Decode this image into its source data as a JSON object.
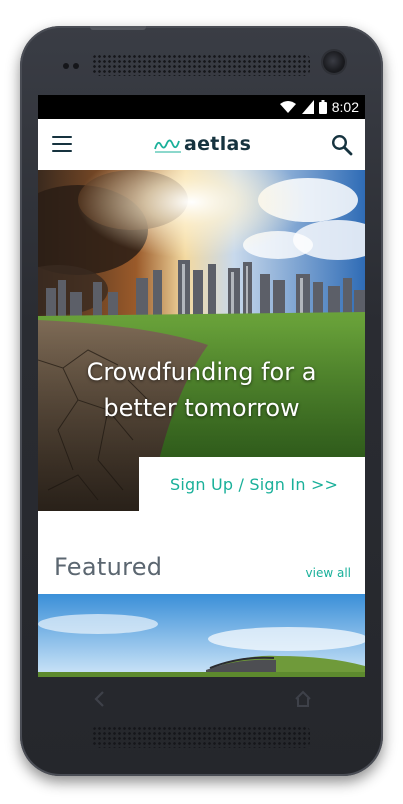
{
  "status_bar": {
    "time": "8:02",
    "icons": [
      "wifi-icon",
      "signal-icon",
      "battery-icon"
    ]
  },
  "app_bar": {
    "brand": "aetlas",
    "menu_icon": "hamburger-menu-icon",
    "search_icon": "search-icon"
  },
  "hero": {
    "title_line1": "Crowdfunding for a",
    "title_line2": "better tomorrow",
    "cta_label": "Sign Up / Sign In >>"
  },
  "featured": {
    "heading": "Featured",
    "view_all_label": "view all"
  },
  "device": {
    "back_icon": "back-arrow-icon",
    "home_icon": "home-icon"
  },
  "colors": {
    "brand_dark": "#16333f",
    "accent_teal": "#1ab09a",
    "heading_gray": "#5b6670",
    "device_body": "#2a2c32"
  }
}
